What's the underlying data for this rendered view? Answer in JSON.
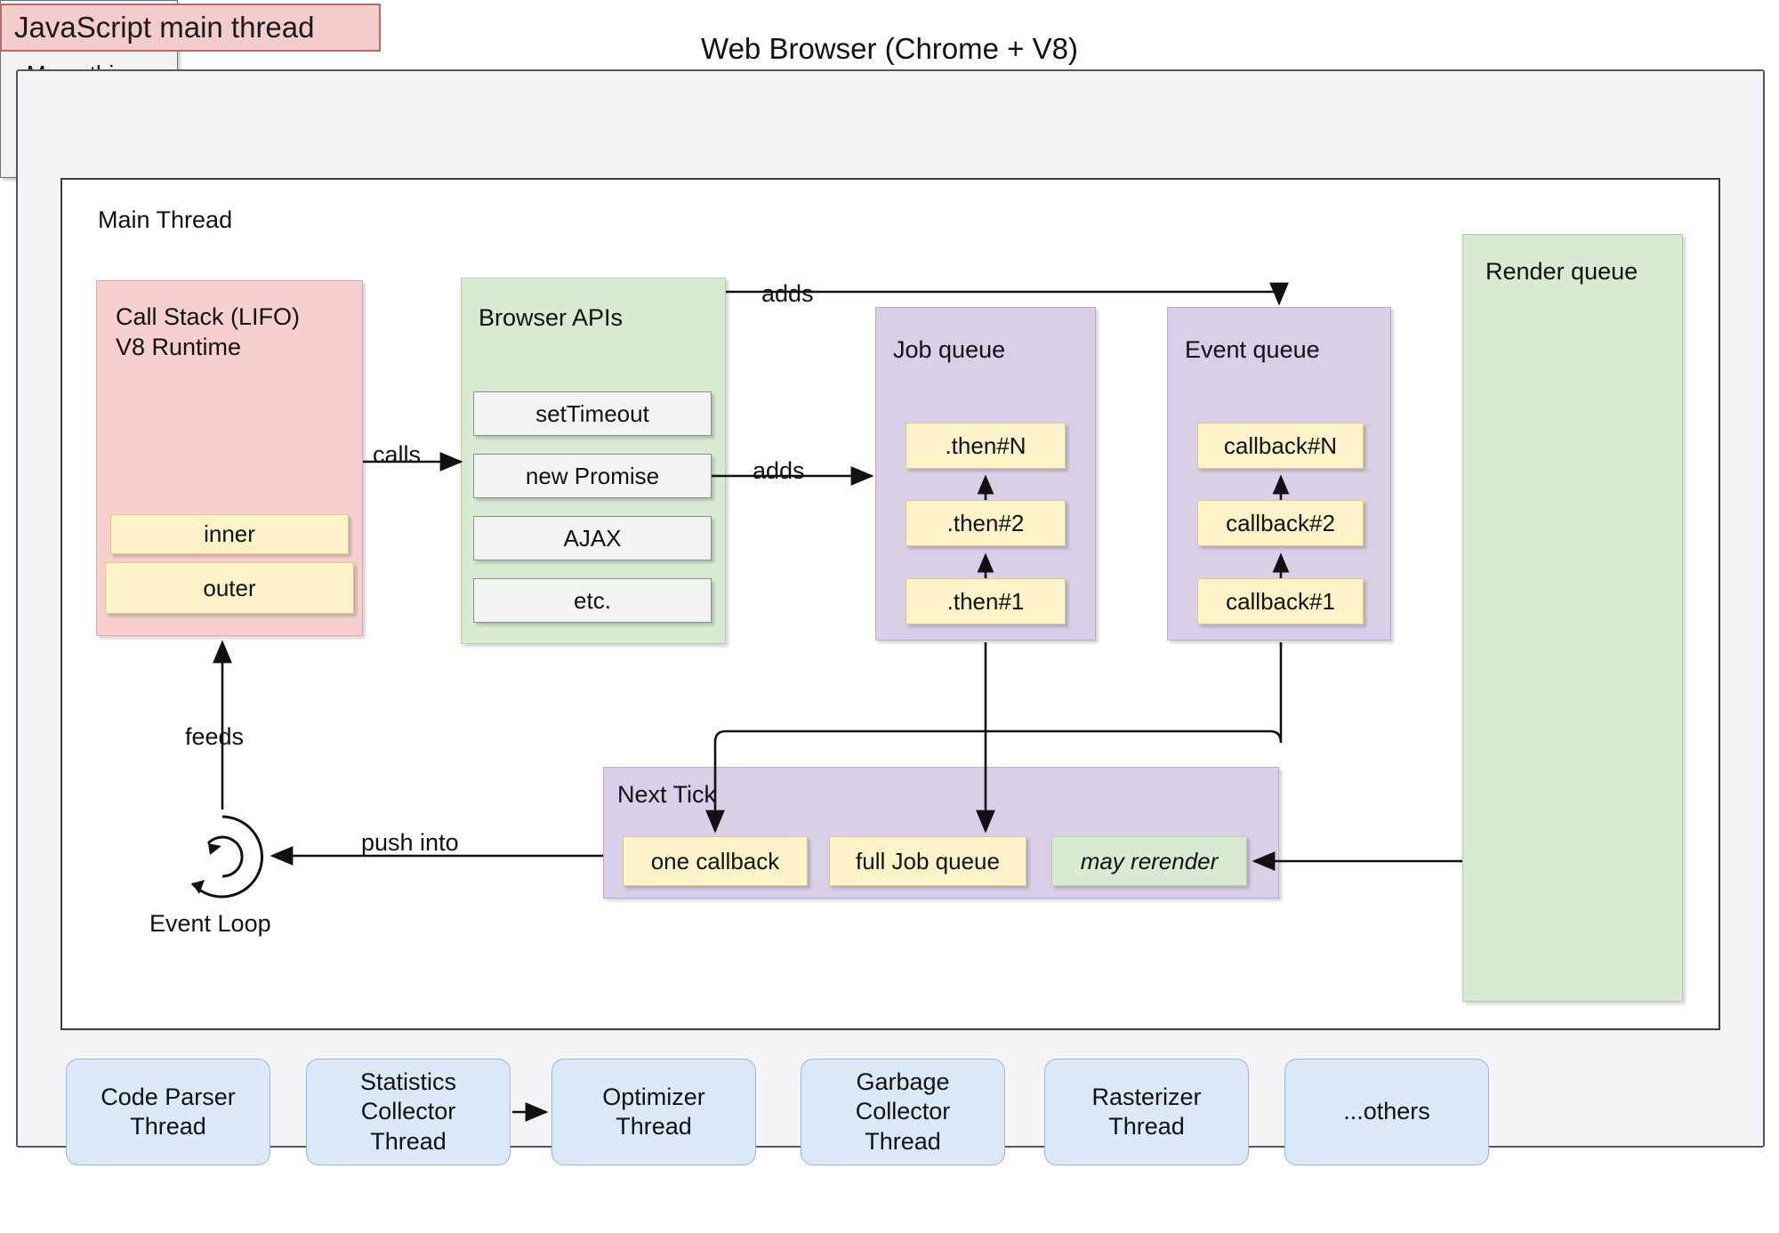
{
  "title_badge": {
    "label": "JavaScript main thread"
  },
  "browser": {
    "title": "Web Browser (Chrome + V8)"
  },
  "main_thread": {
    "label": "Main Thread"
  },
  "call_stack": {
    "title": "Call Stack (LIFO)\nV8 Runtime",
    "frames": [
      {
        "label": "inner"
      },
      {
        "label": "outer"
      }
    ]
  },
  "browser_apis": {
    "title": "Browser APIs",
    "items": [
      {
        "label": "setTimeout"
      },
      {
        "label": "new Promise"
      },
      {
        "label": "AJAX"
      },
      {
        "label": "etc."
      }
    ]
  },
  "job_queue": {
    "title": "Job queue",
    "items": [
      {
        "label": ".then#N"
      },
      {
        "label": ".then#2"
      },
      {
        "label": ".then#1"
      }
    ]
  },
  "event_queue": {
    "title": "Event queue",
    "items": [
      {
        "label": "callback#N"
      },
      {
        "label": "callback#2"
      },
      {
        "label": "callback#1"
      }
    ]
  },
  "render_queue": {
    "title": "Render queue",
    "inner": {
      "label": "Many things\nhappen here"
    }
  },
  "next_tick": {
    "title": "Next Tick",
    "items": [
      {
        "label": "one callback"
      },
      {
        "label": "full Job queue"
      },
      {
        "label": "may rerender"
      }
    ]
  },
  "event_loop": {
    "label": "Event Loop",
    "icon": "circular-arrow-icon"
  },
  "edges": {
    "calls": "calls",
    "adds_top": "adds",
    "adds_mid": "adds",
    "feeds": "feeds",
    "push_into": "push into"
  },
  "worker_threads": [
    {
      "label": "Code Parser\nThread"
    },
    {
      "label": "Statistics\nCollector\nThread"
    },
    {
      "label": "Optimizer\nThread"
    },
    {
      "label": "Garbage\nCollector\nThread"
    },
    {
      "label": "Rasterizer\nThread"
    },
    {
      "label": "...others"
    }
  ],
  "colors": {
    "badge_bg": "#f4cccc",
    "call_stack_bg": "#f7cfce",
    "api_bg": "#d9ead3",
    "queue_bg": "#d9cfe8",
    "chip_yellow": "#fdf2c8",
    "thread_bg": "#dae8f7",
    "render_bg": "#d9ead3"
  }
}
